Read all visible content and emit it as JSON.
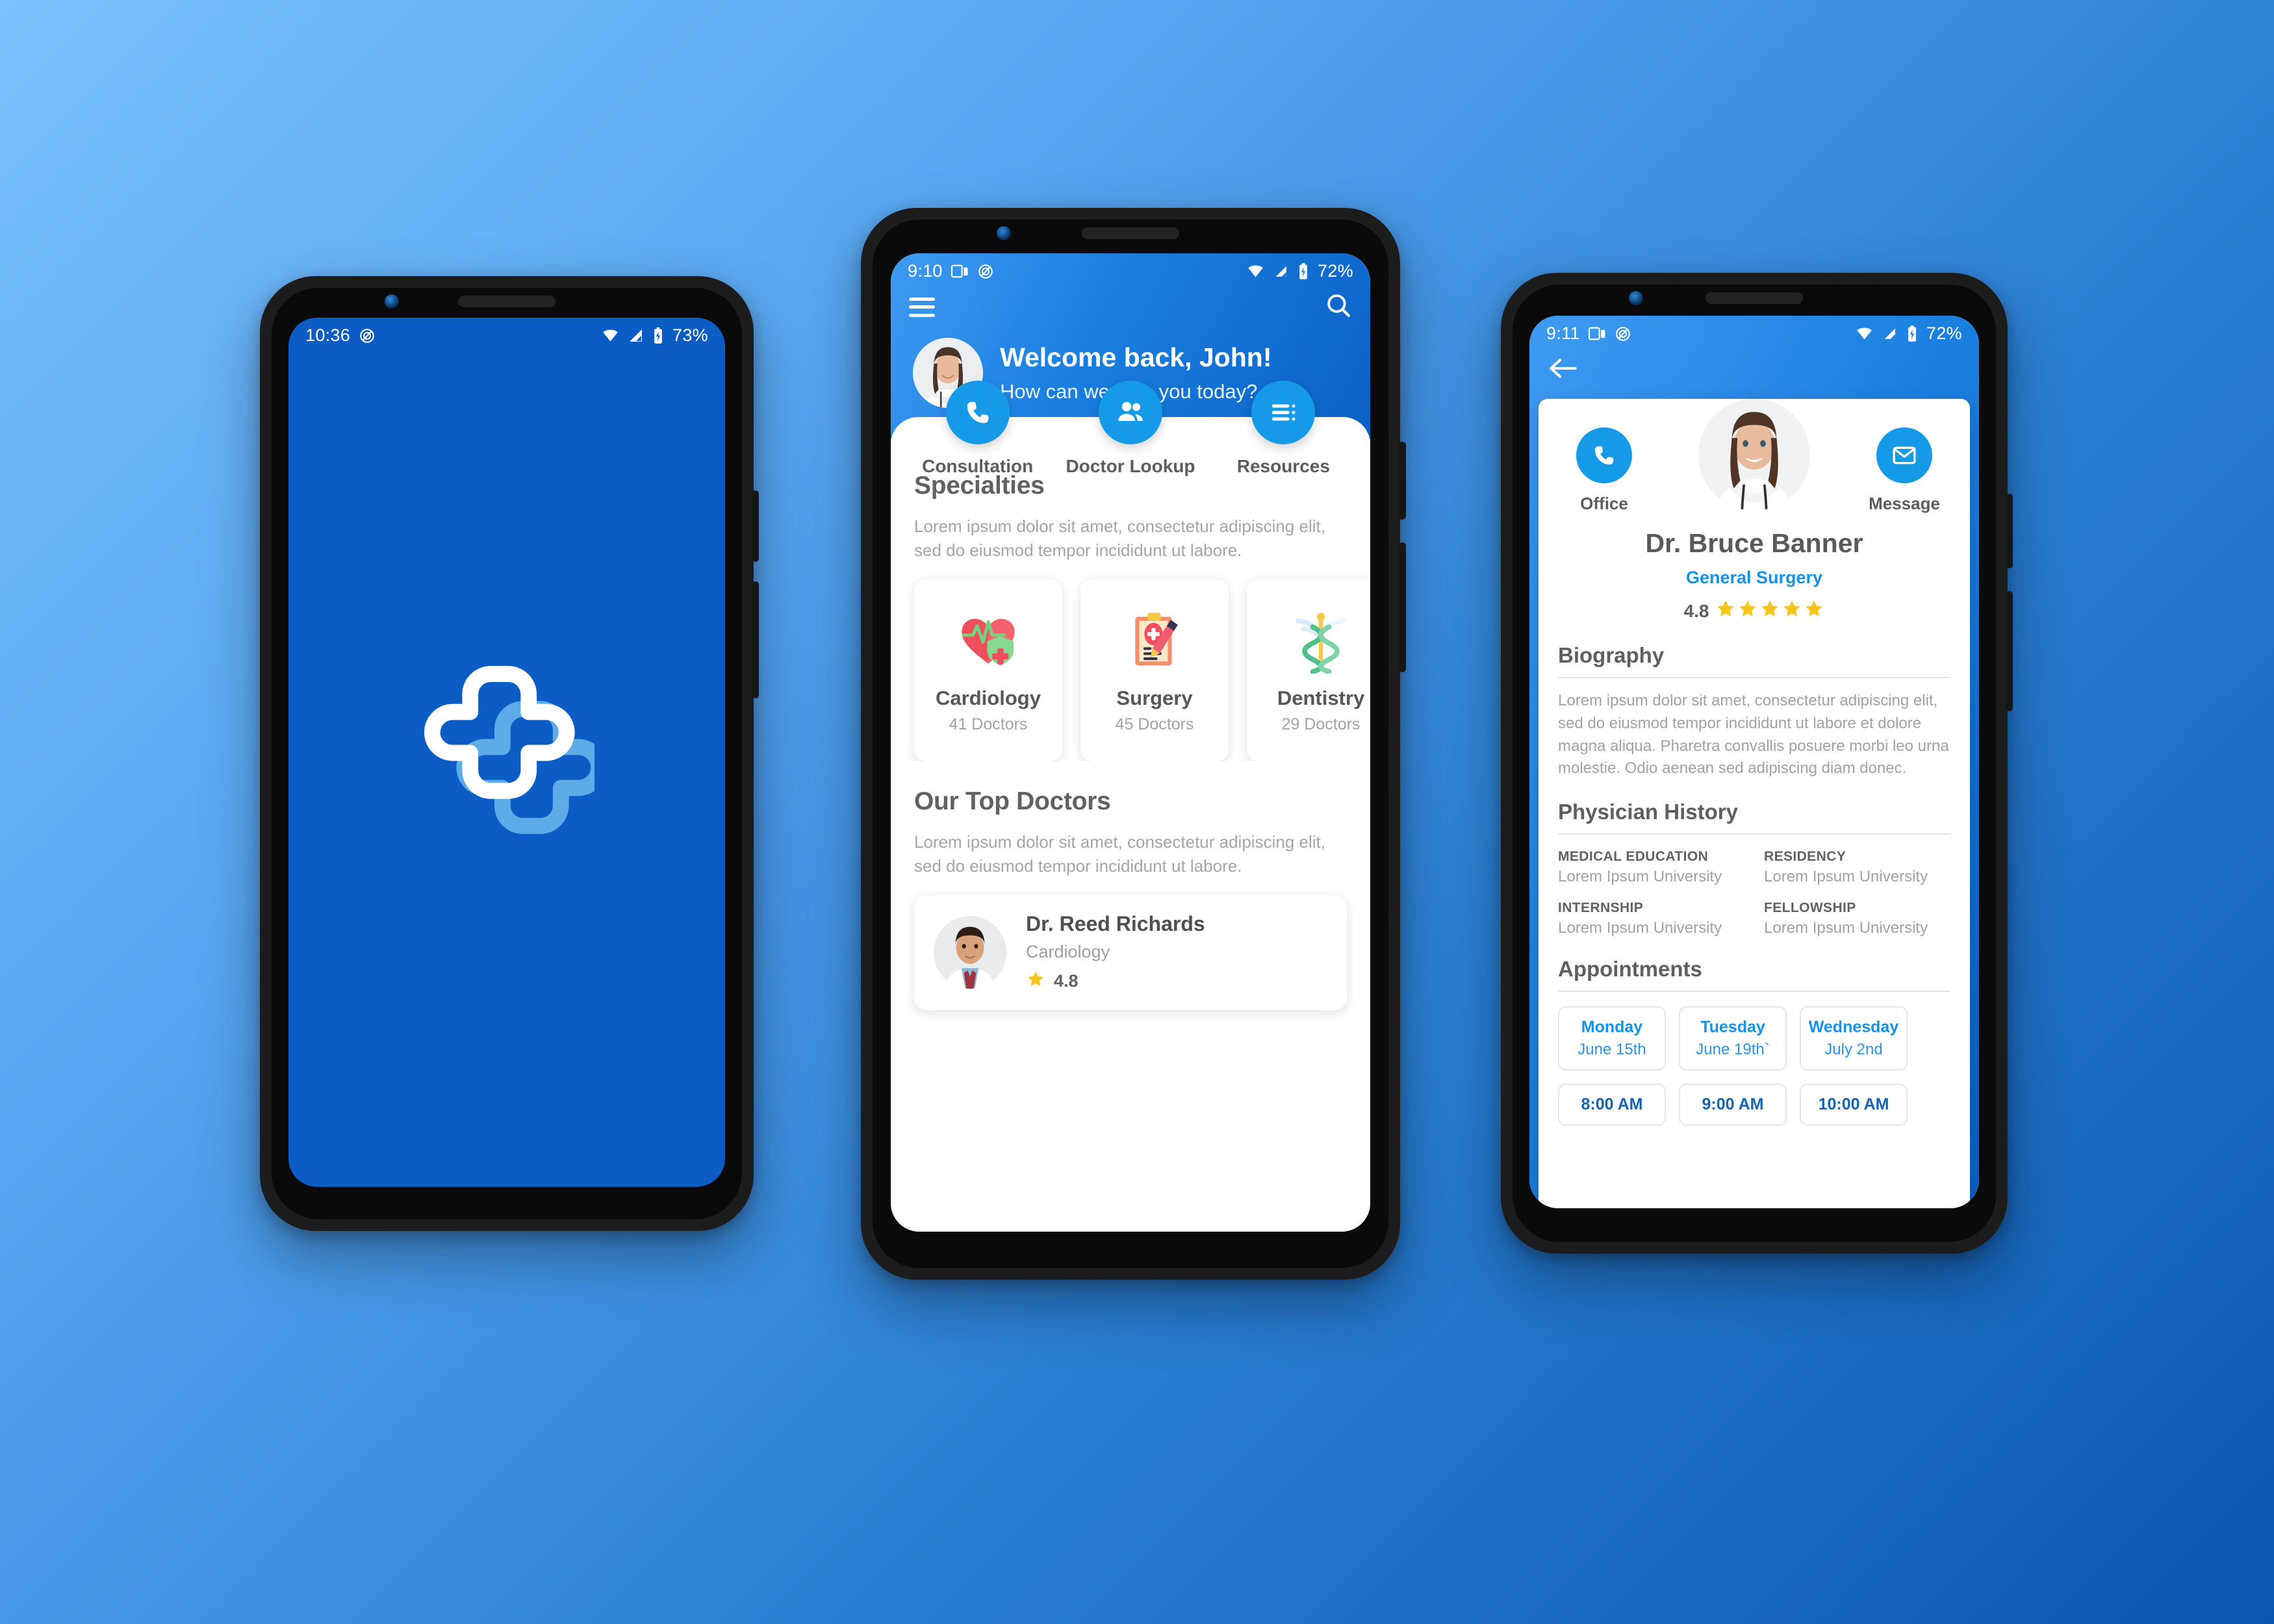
{
  "background": {
    "from": "#7ac0fa",
    "to": "#0b57b0"
  },
  "theme": {
    "primary": "#0b5cc4",
    "accent": "#159ae8",
    "link": "#1592ea",
    "star": "#f5c518"
  },
  "splash_phone": {
    "status": {
      "time": "10:36",
      "dnd_icon": "do-not-disturb-icon",
      "wifi_icon": "wifi-icon",
      "signal_icon": "signal-icon",
      "battery_icon": "battery-charging-icon",
      "battery": "73%"
    },
    "logo_name": "app-logo"
  },
  "home_phone": {
    "status": {
      "time": "9:10",
      "cast_icon": "cast-screen-icon",
      "dnd_icon": "do-not-disturb-icon",
      "wifi_icon": "wifi-icon",
      "signal_icon": "signal-icon",
      "battery_icon": "battery-charging-icon",
      "battery": "72%"
    },
    "appbar": {
      "menu_icon": "hamburger-menu-icon",
      "search_icon": "search-icon"
    },
    "hero": {
      "greeting": "Welcome back, John!",
      "subtitle": "How can we help you today?"
    },
    "quick_actions": [
      {
        "label": "Consultation",
        "icon": "phone-icon"
      },
      {
        "label": "Doctor Lookup",
        "icon": "people-icon"
      },
      {
        "label": "Resources",
        "icon": "list-icon"
      }
    ],
    "specialties": {
      "title": "Specialties",
      "description": "Lorem ipsum dolor sit amet, consectetur adipiscing elit, sed do eiusmod tempor incididunt ut labore.",
      "cards": [
        {
          "name": "Cardiology",
          "count": "41 Doctors",
          "icon": "heart-shield-icon"
        },
        {
          "name": "Surgery",
          "count": "45 Doctors",
          "icon": "clipboard-pen-icon"
        },
        {
          "name": "Dentistry",
          "count": "29 Doctors",
          "icon": "caduceus-icon"
        }
      ]
    },
    "top_doctors": {
      "title": "Our Top Doctors",
      "description": "Lorem ipsum dolor sit amet, consectetur adipiscing elit, sed do eiusmod tempor incididunt ut labore.",
      "list": [
        {
          "name": "Dr. Reed Richards",
          "specialty": "Cardiology",
          "rating": "4.8",
          "star_icon": "star-icon"
        }
      ]
    }
  },
  "profile_phone": {
    "status": {
      "time": "9:11",
      "cast_icon": "cast-screen-icon",
      "dnd_icon": "do-not-disturb-icon",
      "wifi_icon": "wifi-icon",
      "signal_icon": "signal-icon",
      "battery_icon": "battery-charging-icon",
      "battery": "72%"
    },
    "back_icon": "arrow-back-icon",
    "actions": [
      {
        "label": "Office",
        "icon": "phone-icon"
      },
      {
        "label": "Message",
        "icon": "envelope-icon"
      }
    ],
    "doctor": {
      "name": "Dr. Bruce Banner",
      "field": "General Surgery",
      "rating": "4.8",
      "stars": 5
    },
    "biography": {
      "title": "Biography",
      "text": "Lorem ipsum dolor sit amet, consectetur adipiscing elit, sed do eiusmod tempor incididunt ut labore et dolore magna aliqua. Pharetra convallis posuere morbi leo urna molestie. Odio aenean sed adipiscing diam donec."
    },
    "physician_history": {
      "title": "Physician History",
      "entries": [
        {
          "label": "MEDICAL EDUCATION",
          "value": "Lorem Ipsum University"
        },
        {
          "label": "RESIDENCY",
          "value": "Lorem Ipsum University"
        },
        {
          "label": "INTERNSHIP",
          "value": "Lorem Ipsum University"
        },
        {
          "label": "FELLOWSHIP",
          "value": "Lorem Ipsum University"
        }
      ]
    },
    "appointments": {
      "title": "Appointments",
      "days": [
        {
          "day": "Monday",
          "date": "June 15th"
        },
        {
          "day": "Tuesday",
          "date": "June 19th`"
        },
        {
          "day": "Wednesday",
          "date": "July 2nd"
        }
      ],
      "slots": [
        {
          "time": "8:00 AM"
        },
        {
          "time": "9:00 AM"
        },
        {
          "time": "10:00 AM"
        }
      ]
    }
  }
}
